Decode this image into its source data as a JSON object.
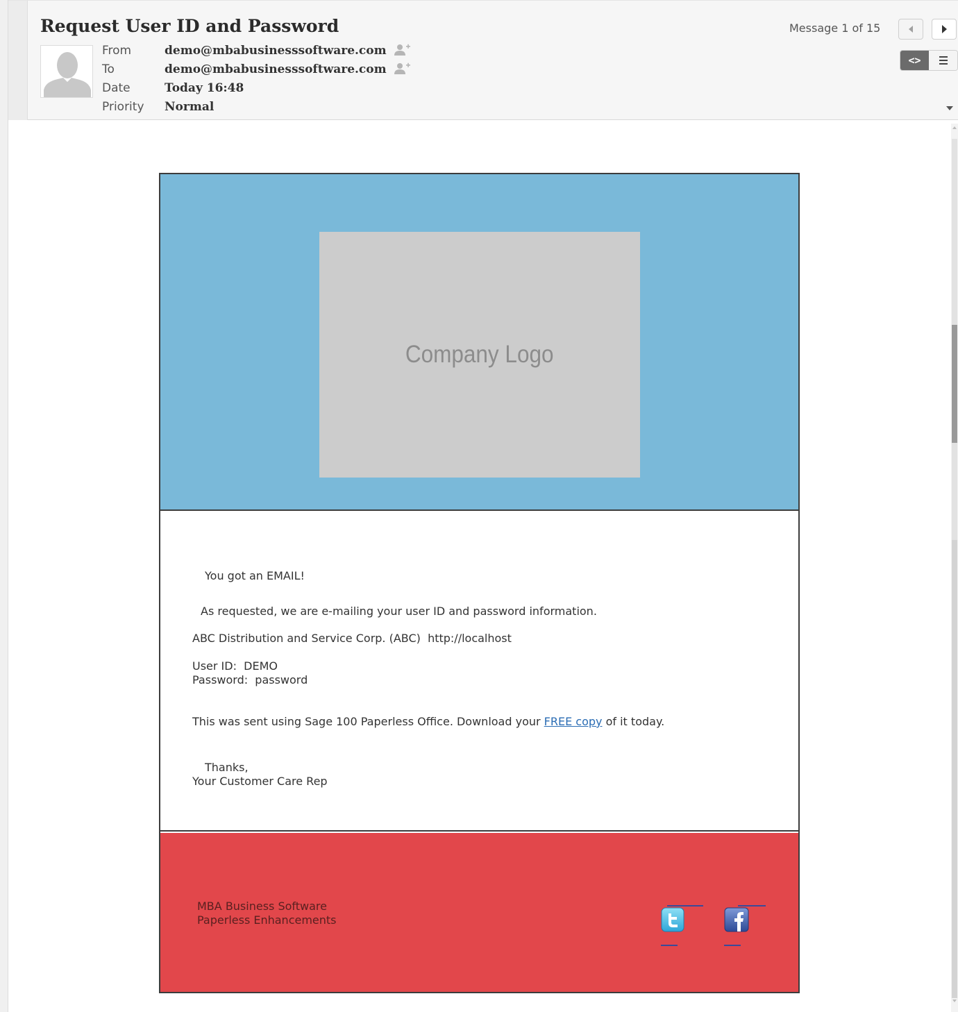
{
  "header": {
    "subject": "Request User ID and Password",
    "message_counter": "Message 1 of 15",
    "fields": [
      {
        "label": "From",
        "value": "demo@mbabusinesssoftware.com"
      },
      {
        "label": "To",
        "value": "demo@mbabusinesssoftware.com"
      },
      {
        "label": "Date",
        "value": "Today 16:48"
      },
      {
        "label": "Priority",
        "value": "Normal"
      }
    ],
    "view_html_label": "<>"
  },
  "email": {
    "logo_text": "Company Logo",
    "greeting": "You got an EMAIL!",
    "intro": "As requested, we are e-mailing your user ID and password information.",
    "company_line": "ABC Distribution and Service Corp. (ABC)  http://localhost",
    "user_id_line": "User ID:  DEMO",
    "password_line": "Password:  password",
    "sent_prefix": "This was sent using Sage 100 Paperless Office. Download your ",
    "sent_link": "FREE copy",
    "sent_suffix": " of it today.",
    "thanks": "Thanks,",
    "signature": "Your Customer Care Rep",
    "footer_line1": "MBA Business Software",
    "footer_line2": "Paperless Enhancements"
  },
  "colors": {
    "banner": "#7ab9d9",
    "footer": "#e2474b",
    "logo_placeholder": "#cccccc",
    "link": "#2b6db4"
  },
  "icons": [
    "avatar-icon",
    "add-contact-icon",
    "prev-arrow-icon",
    "next-arrow-icon",
    "html-view-icon",
    "plain-text-view-icon",
    "twitter-icon",
    "facebook-icon"
  ]
}
